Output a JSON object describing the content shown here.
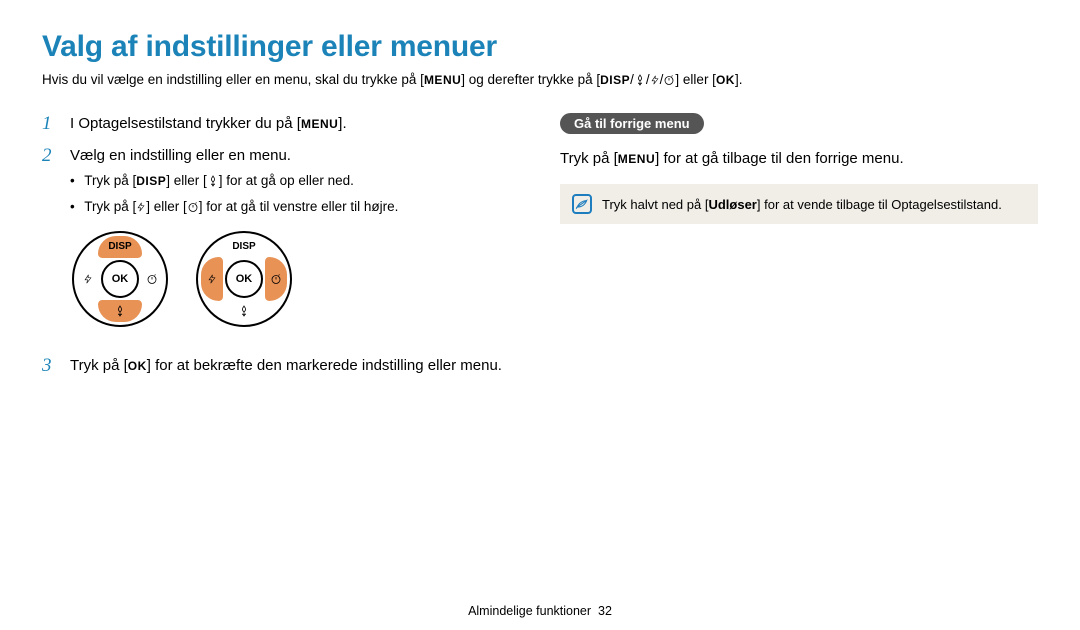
{
  "title": "Valg af indstillinger eller menuer",
  "intro": {
    "pre": "Hvis du vil vælge en indstilling eller en menu, skal du trykke på [",
    "menu": "MENU",
    "mid": "] og derefter trykke på [",
    "disp": "DISP",
    "post": "] eller [",
    "ok": "OK",
    "end": "]."
  },
  "steps": [
    {
      "n": "1",
      "pre": "I Optagelsestilstand trykker du på [",
      "key": "MENU",
      "post": "]."
    },
    {
      "n": "2",
      "text": "Vælg en indstilling eller en menu.",
      "sub1_pre": "Tryk på [",
      "sub1_disp": "DISP",
      "sub1_mid": "] eller [",
      "sub1_post": "] for at gå op eller ned.",
      "sub2_pre": "Tryk på [",
      "sub2_mid": "] eller [",
      "sub2_post": "] for at gå til venstre eller til højre."
    },
    {
      "n": "3",
      "pre": "Tryk på [",
      "key": "OK",
      "post": "] for at bekræfte den markerede indstilling eller menu."
    }
  ],
  "dial": {
    "disp": "DISP",
    "ok": "OK"
  },
  "right": {
    "pill": "Gå til forrige menu",
    "line_pre": "Tryk på [",
    "line_key": "MENU",
    "line_post": "] for at gå tilbage til den forrige menu.",
    "note_pre": "Tryk halvt ned på [",
    "note_bold": "Udløser",
    "note_post": "] for at vende tilbage til Optagelsestilstand."
  },
  "footer": {
    "label": "Almindelige funktioner",
    "page": "32"
  }
}
